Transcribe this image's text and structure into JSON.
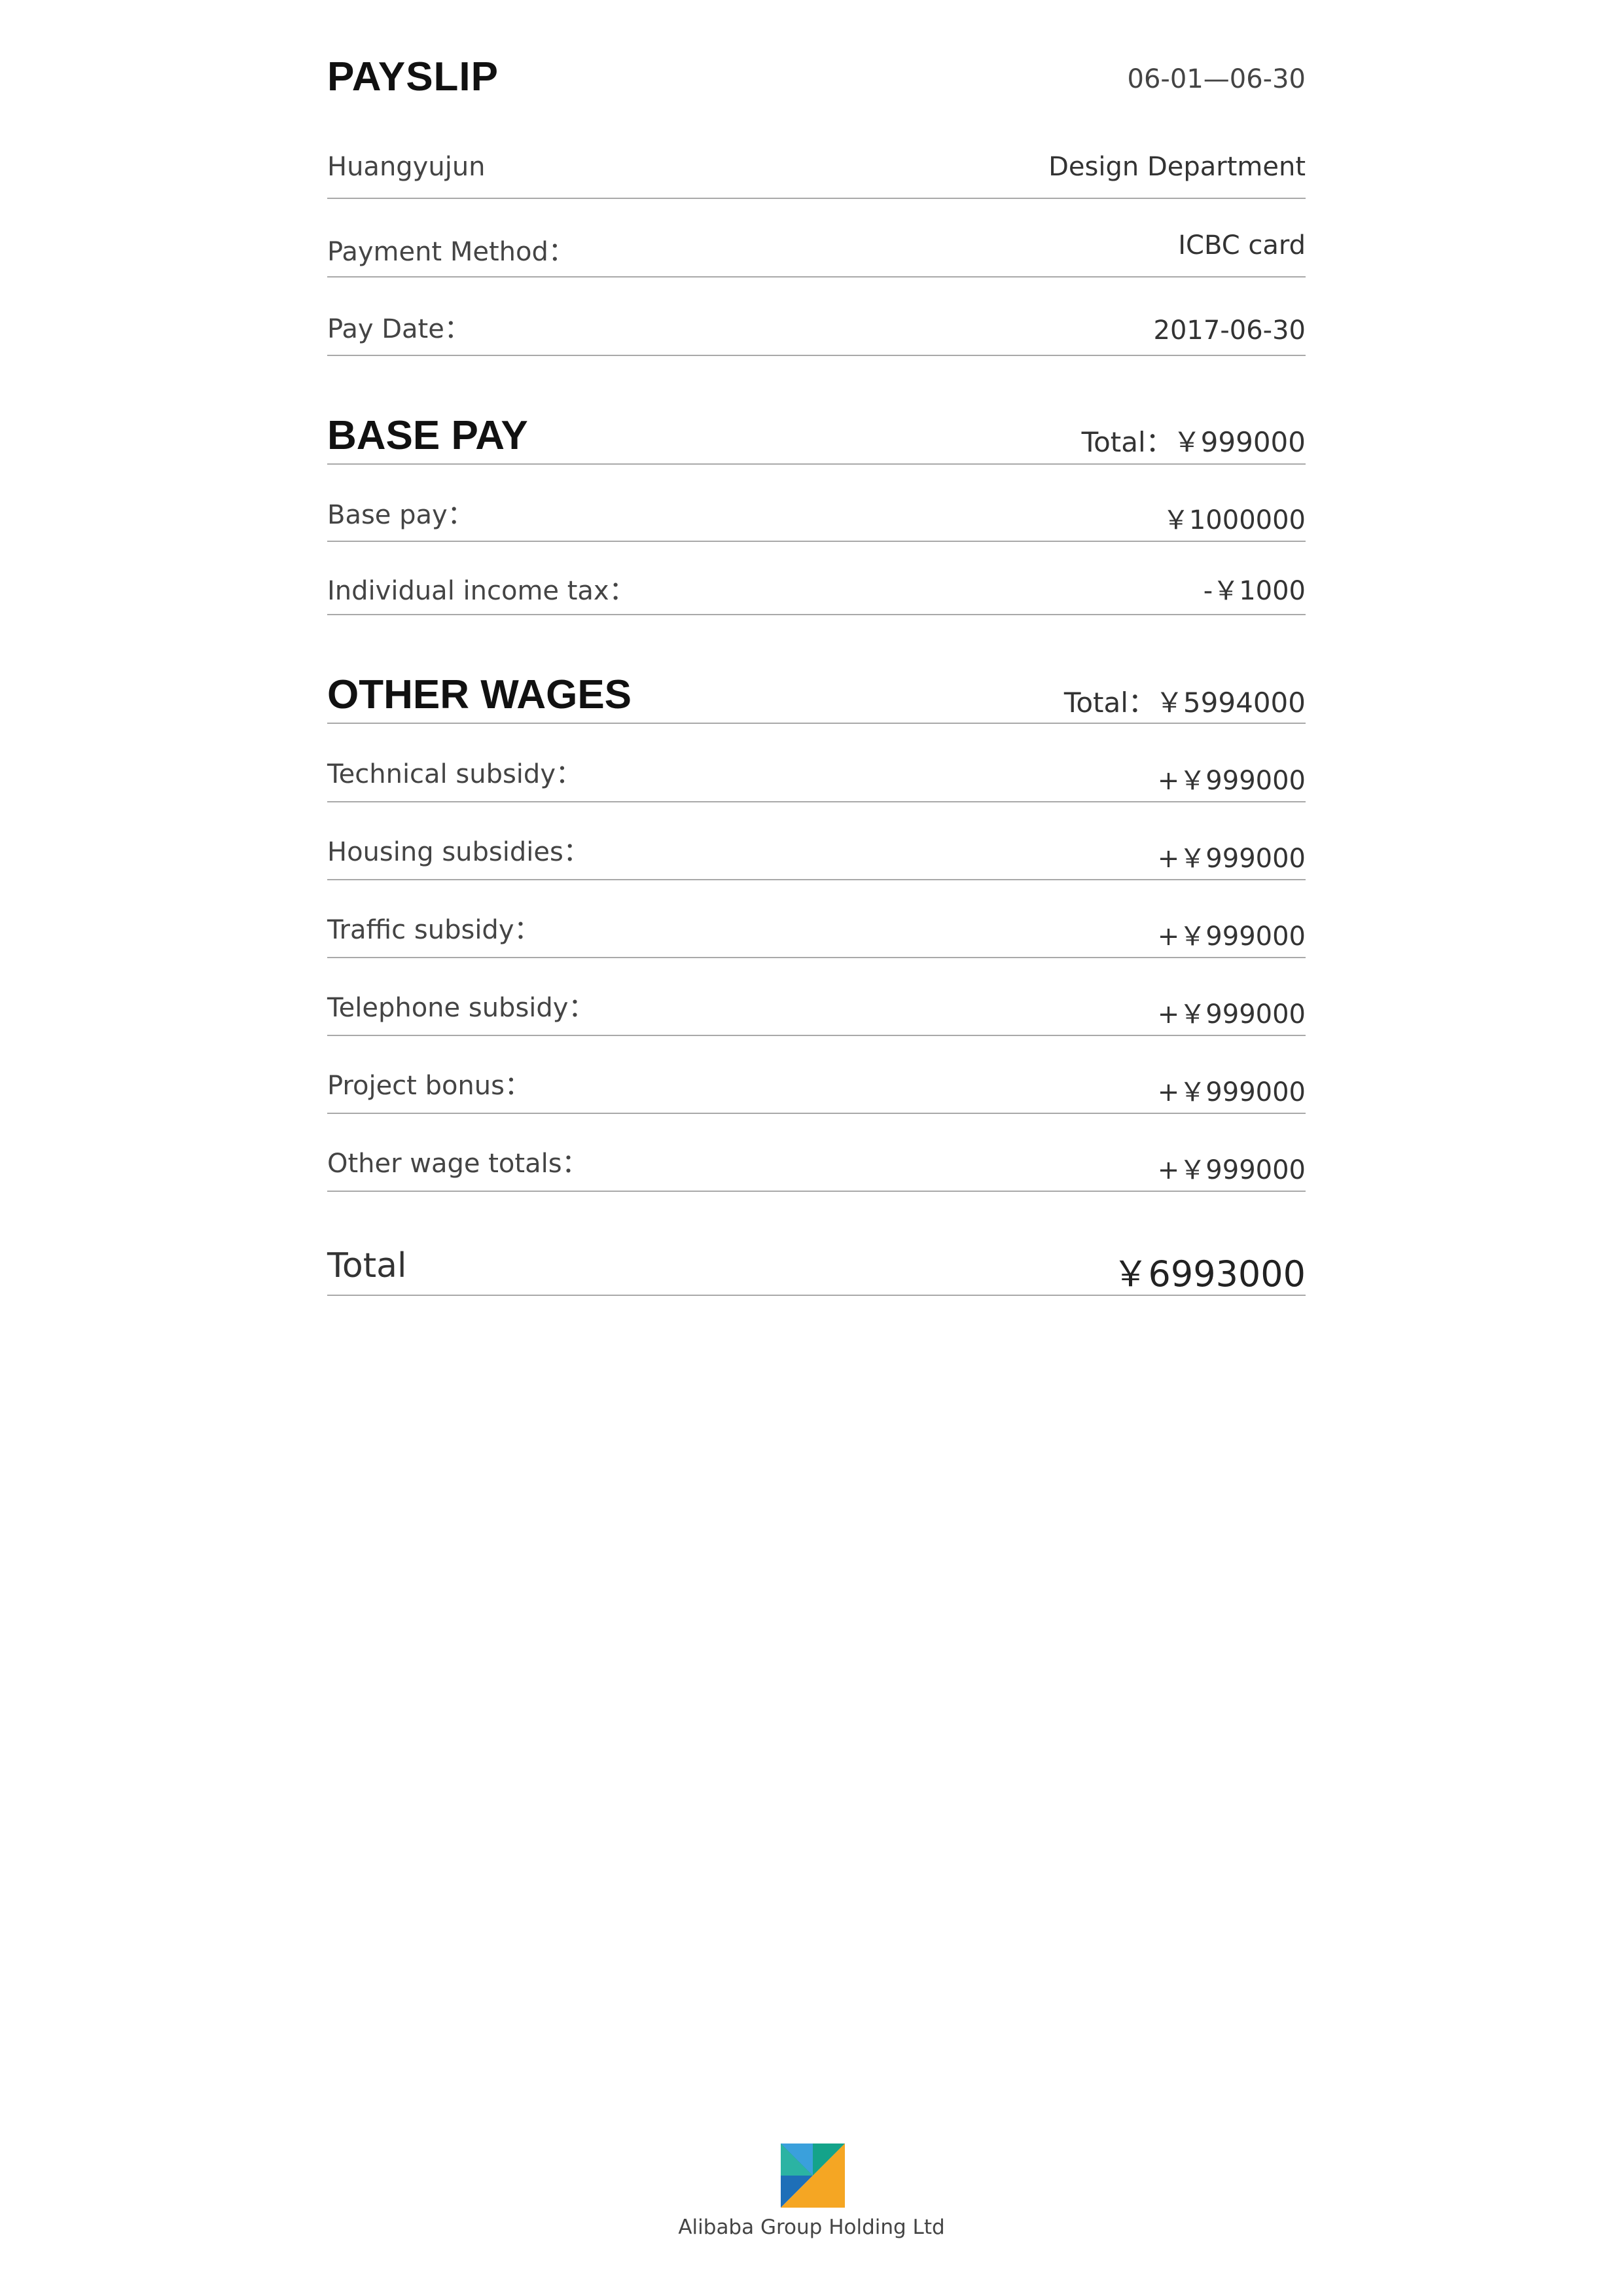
{
  "header": {
    "title": "PAYSLIP",
    "period": "06-01—06-30"
  },
  "info": {
    "employee_name": "Huangyujun",
    "department": "Design Department",
    "payment_method_label": "Payment Method：",
    "payment_method_value": "ICBC card",
    "pay_date_label": "Pay Date：",
    "pay_date_value": "2017-06-30"
  },
  "base_pay": {
    "title": "BASE PAY",
    "total": "Total：￥999000",
    "items": [
      {
        "label": "Base pay：",
        "value": "￥1000000"
      },
      {
        "label": "Individual income tax：",
        "value": "-￥1000"
      }
    ]
  },
  "other_wages": {
    "title": "OTHER WAGES",
    "total": "Total：￥5994000",
    "items": [
      {
        "label": "Technical subsidy：",
        "value": "+￥999000"
      },
      {
        "label": "Housing subsidies：",
        "value": "+￥999000"
      },
      {
        "label": "Traffic subsidy：",
        "value": "+￥999000"
      },
      {
        "label": "Telephone subsidy：",
        "value": "+￥999000"
      },
      {
        "label": "Project bonus：",
        "value": "+￥999000"
      },
      {
        "label": "Other wage totals：",
        "value": "+￥999000"
      }
    ]
  },
  "grand_total": {
    "label": "Total",
    "value": "￥6993000"
  },
  "footer": {
    "company": "Alibaba Group Holding Ltd",
    "logo_icon": "alibaba-logo-icon",
    "logo_colors": [
      "#1a9ad6",
      "#0f8c6e",
      "#f5a623",
      "#2bb3a3",
      "#1e6fb8"
    ]
  }
}
